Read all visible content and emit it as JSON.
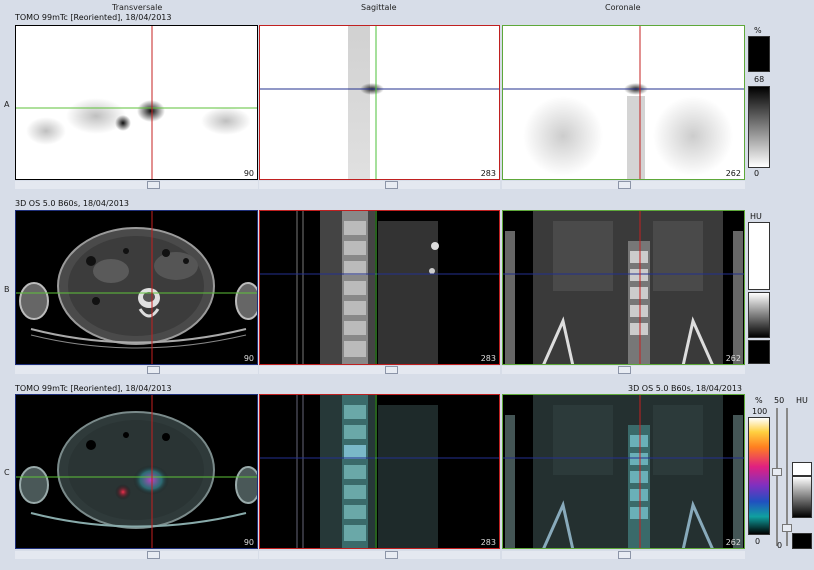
{
  "headers": {
    "transversale": "Transversale",
    "sagittale": "Sagittale",
    "coronale": "Coronale"
  },
  "rows": {
    "A": {
      "label": "A",
      "series": "TOMO 99mTc [Reoriented], 18/04/2013"
    },
    "B": {
      "label": "B",
      "series": "3D  OS  5.0  B60s, 18/04/2013"
    },
    "C": {
      "label": "C",
      "series_left": "TOMO 99mTc [Reoriented], 18/04/2013",
      "series_right": "3D  OS  5.0  B60s, 18/04/2013"
    }
  },
  "slices": {
    "transversale": "90",
    "sagittale": "283",
    "coronale": "262"
  },
  "scales": {
    "a": {
      "unit": "%",
      "value": "68",
      "min": "0"
    },
    "b": {
      "unit": "HU"
    },
    "c_pct": {
      "unit": "%",
      "max": "100",
      "min": "0"
    },
    "c_mid": {
      "value": "50"
    },
    "c_hu": {
      "unit": "HU",
      "min": "0"
    }
  },
  "colors": {
    "background": "#d7dde8",
    "transversal_border": "#1f2f7a",
    "sagittal_border": "#c02020",
    "coronal_border": "#5ea83a",
    "crosshair_vertical_red": "#c42020",
    "crosshair_horizontal_green": "#5ec23a",
    "crosshair_horizontal_blue": "#23308f",
    "crosshair_vertical_green": "#4ec23a"
  }
}
